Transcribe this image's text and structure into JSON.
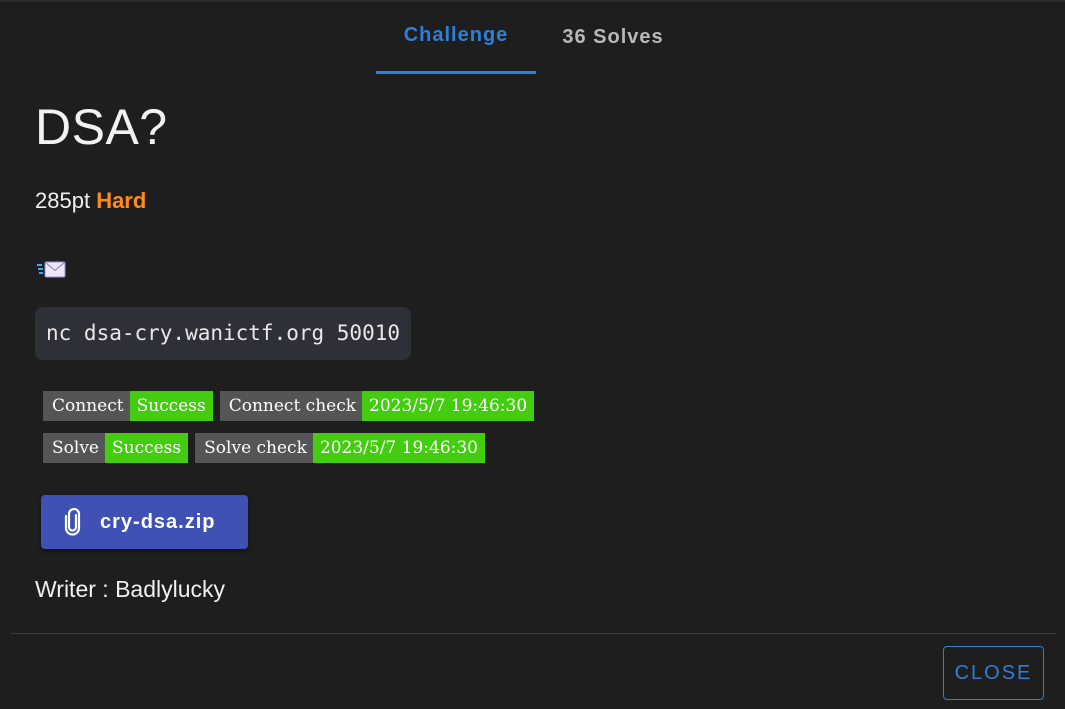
{
  "tabs": [
    {
      "label": "Challenge",
      "active": true
    },
    {
      "label": "36 Solves",
      "active": false
    }
  ],
  "challenge": {
    "title": "DSA?",
    "points": "285pt",
    "difficulty": "Hard",
    "icon": "envelope-with-arrow-icon",
    "command": "nc dsa-cry.wanictf.org 50010",
    "badges": [
      [
        {
          "label": "Connect",
          "value": "Success"
        },
        {
          "label": "Connect check",
          "value": "2023/5/7 19:46:30"
        }
      ],
      [
        {
          "label": "Solve",
          "value": "Success"
        },
        {
          "label": "Solve check",
          "value": "2023/5/7 19:46:30"
        }
      ]
    ],
    "file": {
      "icon": "paperclip-icon",
      "name": "cry-dsa.zip"
    },
    "writer": "Writer : Badlylucky"
  },
  "footer": {
    "close_label": "CLOSE"
  },
  "colors": {
    "accent": "#2f7ed8",
    "difficulty_hard": "#ff8c1a",
    "badge_success": "#44cc11",
    "badge_label": "#555555",
    "file_button": "#3f51b5",
    "background": "#1e1e1e"
  }
}
